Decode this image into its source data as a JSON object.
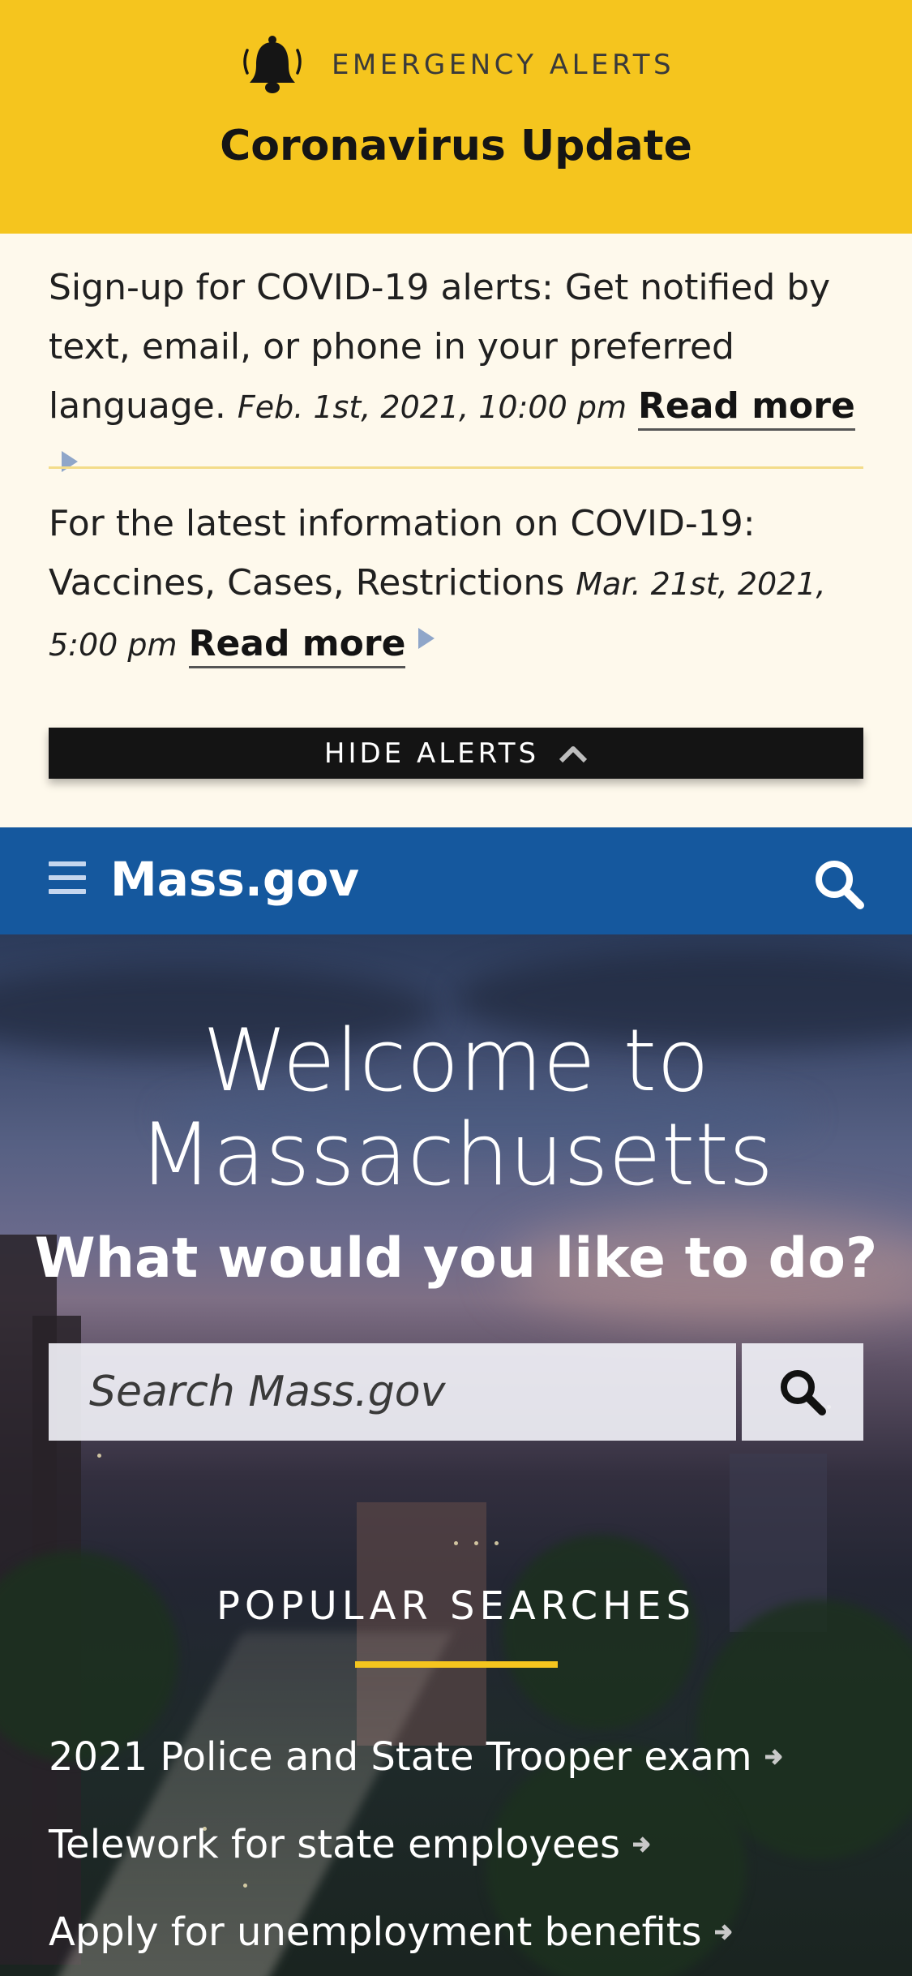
{
  "alert_banner": {
    "label": "EMERGENCY ALERTS",
    "title": "Coronavirus Update",
    "icon": "bell-icon",
    "background_color": "#f5c51e"
  },
  "alerts": [
    {
      "text": "Sign-up for COVID-19 alerts: Get notified by text, email, or phone in your preferred language.",
      "date": "Feb. 1st, 2021, 10:00 pm",
      "link_label": "Read more"
    },
    {
      "text": "For the latest information on COVID-19: Vaccines, Cases, Restrictions",
      "date": "Mar. 21st, 2021, 5:00 pm",
      "link_label": "Read more"
    }
  ],
  "hide_alerts": {
    "label": "HIDE ALERTS",
    "icon": "caret-up-icon"
  },
  "nav": {
    "logo": "Mass.gov",
    "menu_icon": "menu-icon",
    "search_icon": "search-icon",
    "background_color": "#15589e"
  },
  "hero": {
    "heading": "Welcome to Massachusetts",
    "subheading": "What would you like to do?",
    "search": {
      "placeholder": "Search Mass.gov",
      "button_icon": "search-icon"
    }
  },
  "popular": {
    "title": "POPULAR SEARCHES",
    "accent_color": "#f5c51e",
    "items": [
      {
        "label": "2021 Police and State Trooper exam"
      },
      {
        "label": "Telework for state employees"
      },
      {
        "label": "Apply for unemployment benefits"
      }
    ]
  }
}
